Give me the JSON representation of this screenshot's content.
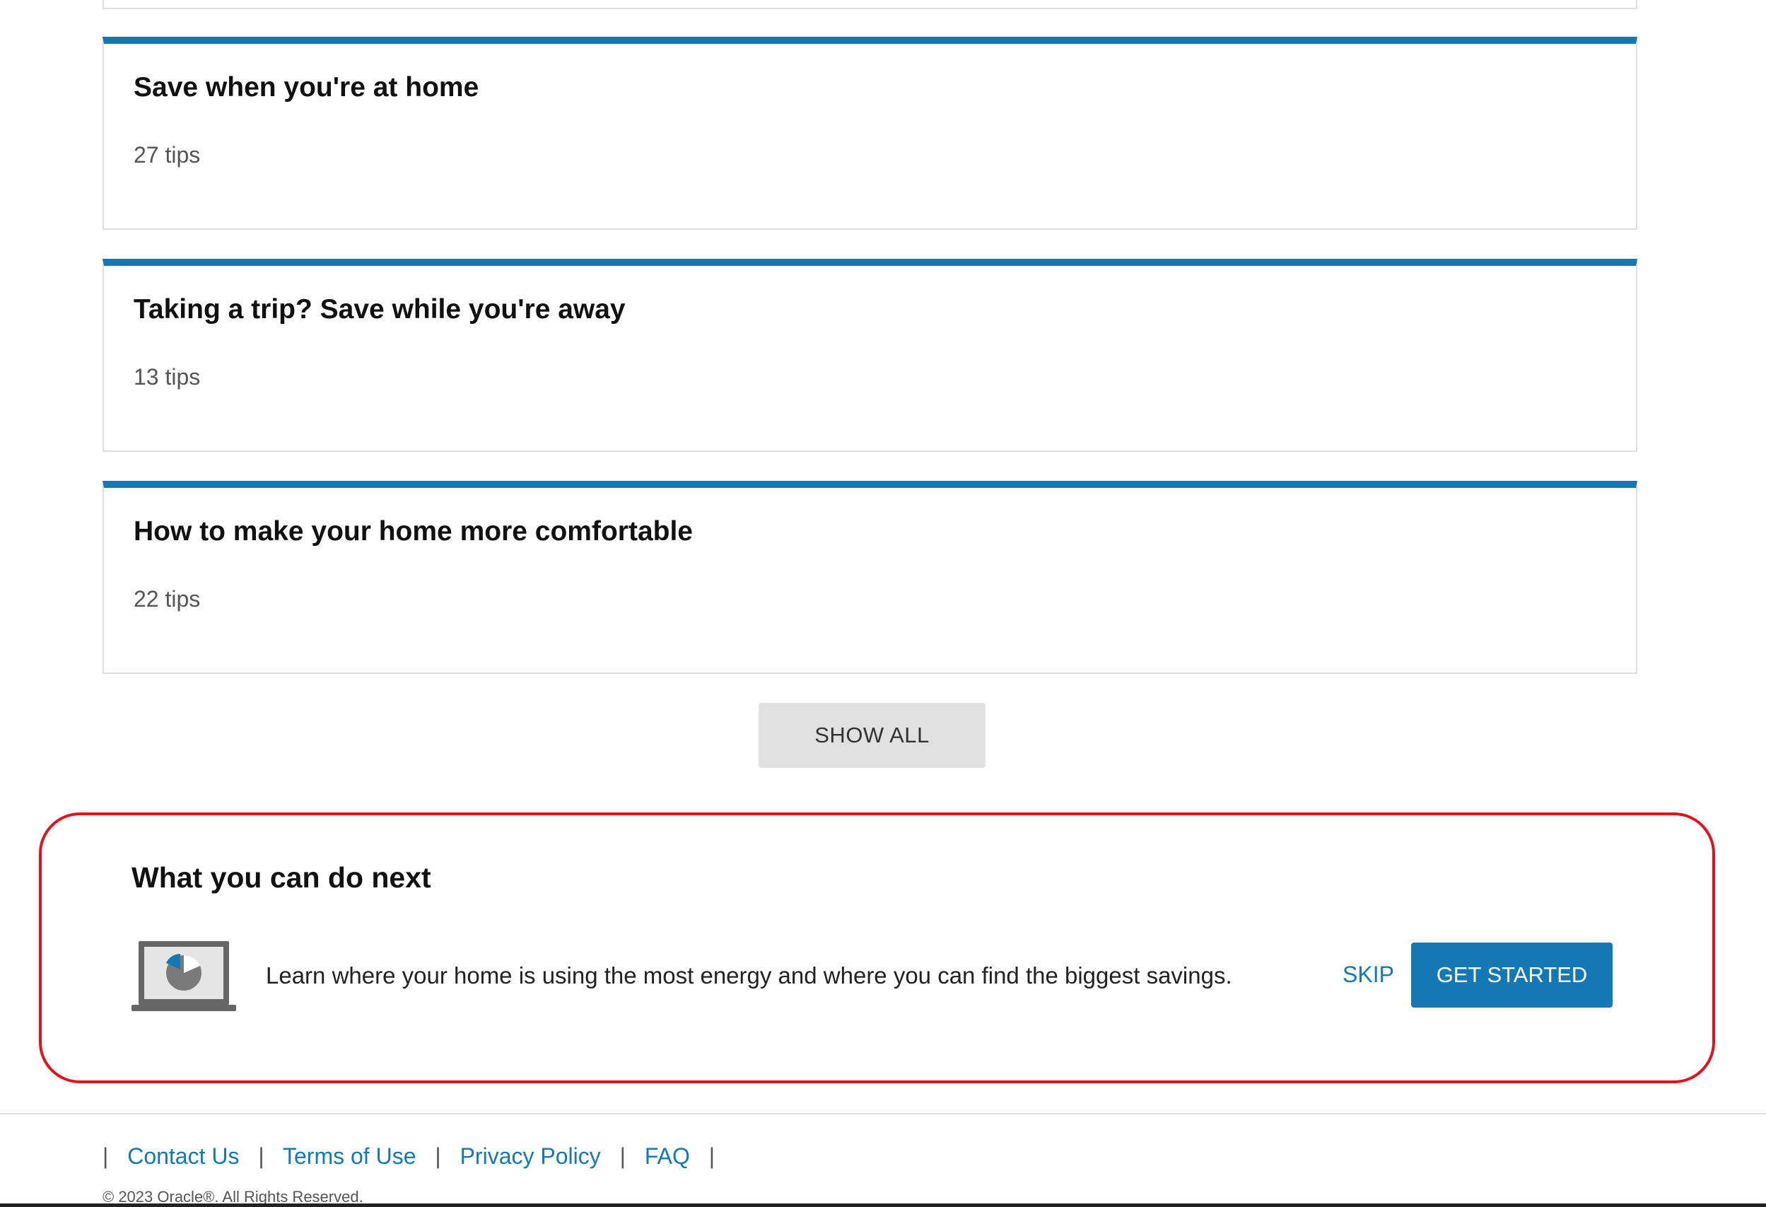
{
  "colors": {
    "accent": "#1378b3",
    "highlight_border": "#e0141e",
    "card_border": "#dedede",
    "secondary_button_bg": "#e1e1e1"
  },
  "tip_categories": [
    {
      "title": "Save when you're at home",
      "count": "27 tips"
    },
    {
      "title": "Taking a trip? Save while you're away",
      "count": "13 tips"
    },
    {
      "title": "How to make your home more comfortable",
      "count": "22 tips"
    }
  ],
  "show_all_label": "SHOW ALL",
  "next_steps": {
    "title": "What you can do next",
    "icon": "laptop-pie-chart-icon",
    "description": "Learn where your home is using the most energy and where you can find the biggest savings.",
    "skip_label": "SKIP",
    "get_started_label": "GET STARTED"
  },
  "footer": {
    "separator": "|",
    "links": [
      "Contact Us",
      "Terms of Use",
      "Privacy Policy",
      "FAQ"
    ],
    "copyright": "© 2023 Oracle®. All Rights Reserved."
  }
}
